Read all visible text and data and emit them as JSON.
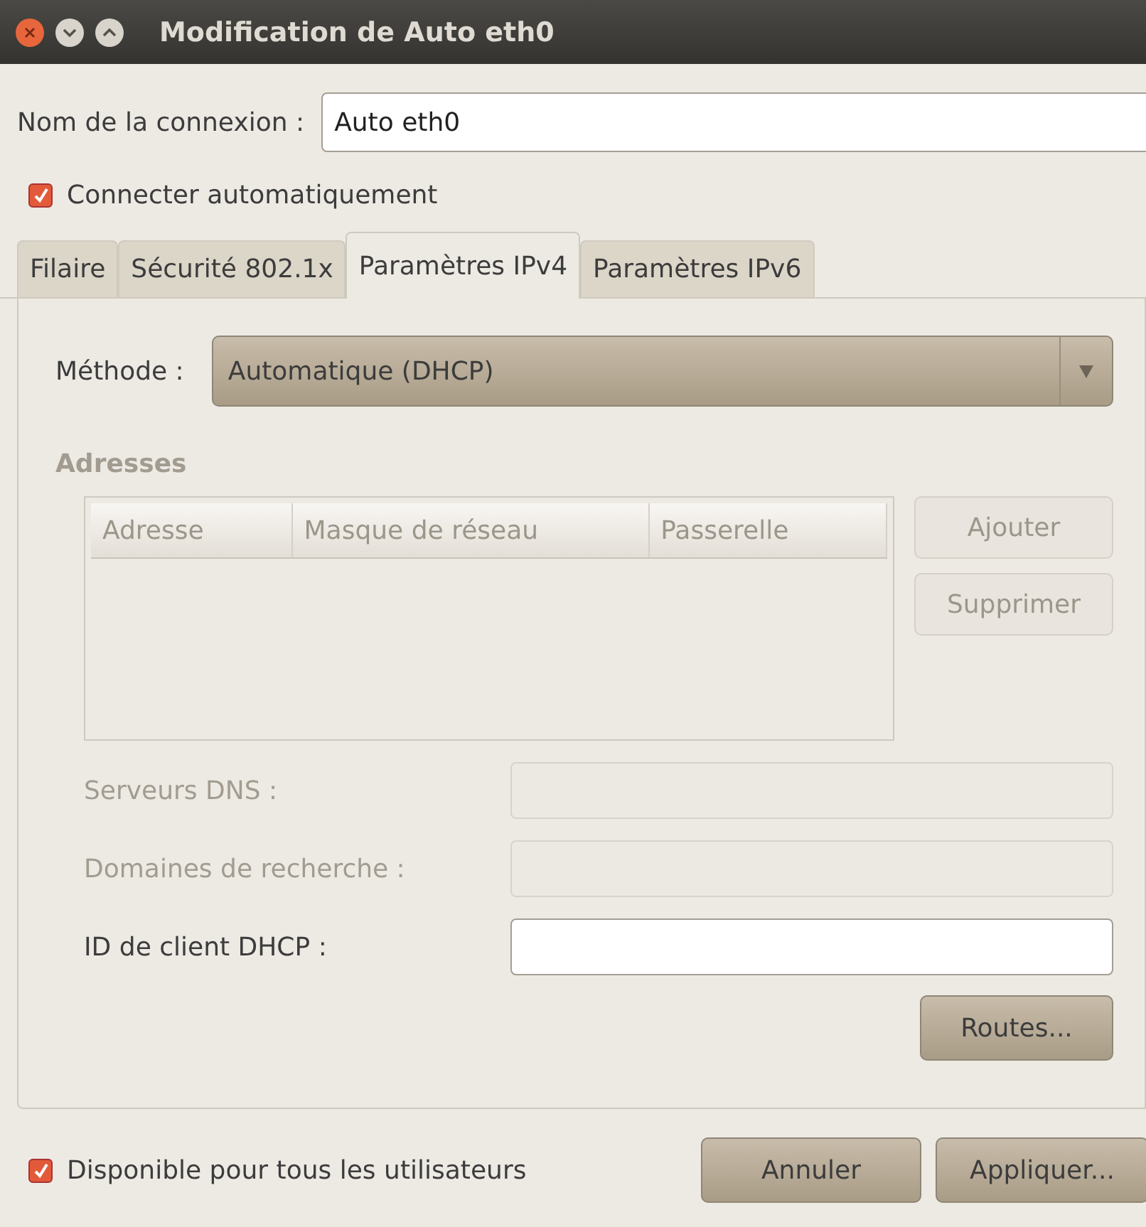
{
  "window": {
    "title": "Modification de Auto eth0"
  },
  "connection_name": {
    "label": "Nom de la connexion :",
    "value": "Auto eth0"
  },
  "auto_connect": {
    "label": "Connecter automatiquement",
    "checked": true
  },
  "tabs": [
    {
      "label": "Filaire",
      "selected": false
    },
    {
      "label": "Sécurité 802.1x",
      "selected": false
    },
    {
      "label": "Paramètres IPv4",
      "selected": true
    },
    {
      "label": "Paramètres IPv6",
      "selected": false
    }
  ],
  "method": {
    "label": "Méthode :",
    "value": "Automatique (DHCP)"
  },
  "addresses": {
    "title": "Adresses",
    "disabled": true,
    "columns": [
      "Adresse",
      "Masque de réseau",
      "Passerelle"
    ],
    "buttons": [
      {
        "label": "Ajouter",
        "disabled": true
      },
      {
        "label": "Supprimer",
        "disabled": true
      }
    ]
  },
  "fields": [
    {
      "label": "Serveurs DNS :",
      "disabled": true
    },
    {
      "label": "Domaines de recherche :",
      "disabled": true
    },
    {
      "label": "ID de client DHCP :",
      "disabled": false
    }
  ],
  "routes_button": "Routes...",
  "all_users": {
    "label": "Disponible pour tous les utilisateurs",
    "checked": true
  },
  "buttons": [
    "Annuler",
    "Appliquer..."
  ]
}
